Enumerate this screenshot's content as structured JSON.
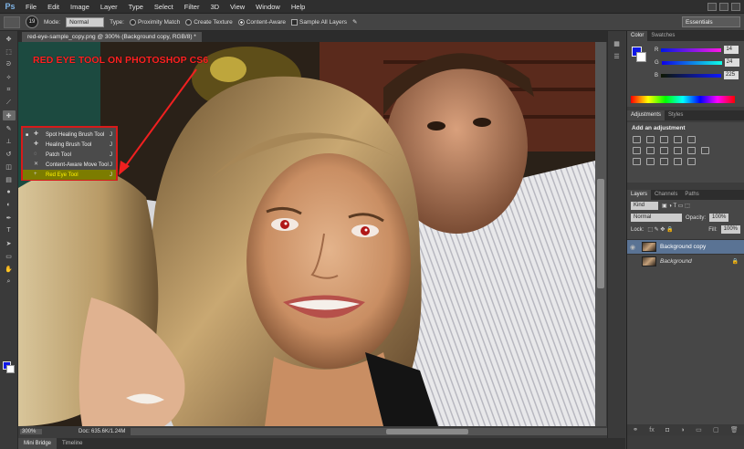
{
  "menubar": {
    "logo": "Ps",
    "items": [
      "File",
      "Edit",
      "Image",
      "Layer",
      "Type",
      "Select",
      "Filter",
      "3D",
      "View",
      "Window",
      "Help"
    ]
  },
  "options": {
    "brush_size": "19",
    "mode_label": "Mode:",
    "mode_value": "Normal",
    "type_label": "Type:",
    "proximity": "Proximity Match",
    "texture": "Create Texture",
    "content_aware": "Content-Aware",
    "sample_all": "Sample All Layers",
    "workspace": "Essentials"
  },
  "document": {
    "tab_title": "red-eye-sample_copy.png @ 300% (Background copy, RGB/8) *",
    "zoom": "300%",
    "doc_size": "Doc: 635.6K/1.24M"
  },
  "annotation": "RED EYE TOOL ON PHOTOSHOP CS6",
  "flyout": {
    "items": [
      {
        "label": "Spot Healing Brush Tool",
        "key": "J"
      },
      {
        "label": "Healing Brush Tool",
        "key": "J"
      },
      {
        "label": "Patch Tool",
        "key": "J"
      },
      {
        "label": "Content-Aware Move Tool",
        "key": "J"
      },
      {
        "label": "Red Eye Tool",
        "key": "J"
      }
    ]
  },
  "bottom_tabs": [
    "Mini Bridge",
    "Timeline"
  ],
  "color_panel": {
    "tabs": [
      "Color",
      "Swatches"
    ],
    "r_label": "R",
    "r_value": "14",
    "g_label": "G",
    "g_value": "24",
    "b_label": "B",
    "b_value": "225",
    "fg_color": "#0f17e6"
  },
  "adjustments": {
    "tabs": [
      "Adjustments",
      "Styles"
    ],
    "title": "Add an adjustment"
  },
  "layers": {
    "tabs": [
      "Layers",
      "Channels",
      "Paths"
    ],
    "kind": "Kind",
    "blend": "Normal",
    "opacity_label": "Opacity:",
    "opacity": "100%",
    "lock_label": "Lock:",
    "fill_label": "Fill:",
    "fill": "100%",
    "items": [
      {
        "name": "Background copy"
      },
      {
        "name": "Background"
      }
    ]
  }
}
